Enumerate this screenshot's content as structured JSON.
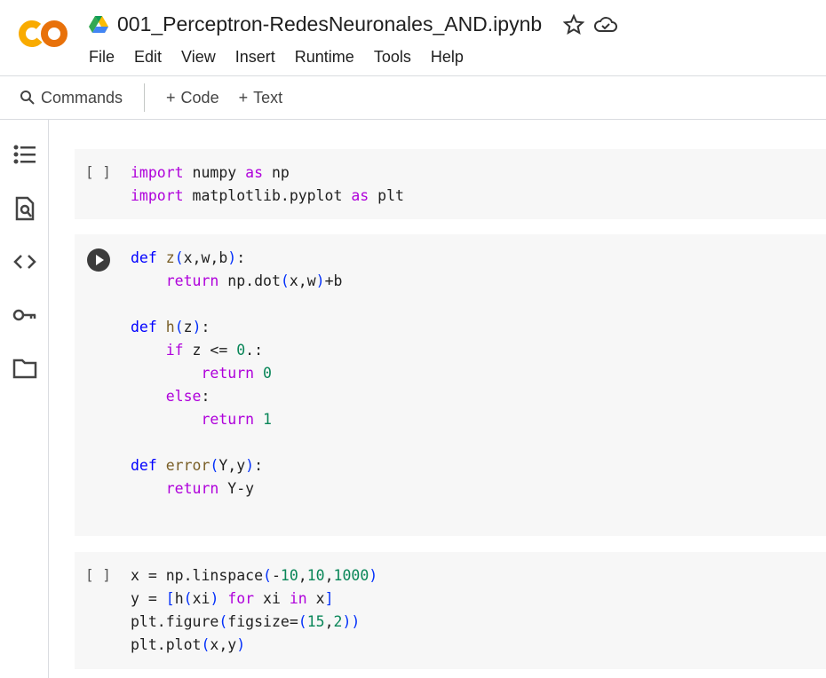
{
  "header": {
    "title": "001_Perceptron-RedesNeuronales_AND.ipynb",
    "logo_text": "CO",
    "menu": [
      "File",
      "Edit",
      "View",
      "Insert",
      "Runtime",
      "Tools",
      "Help"
    ]
  },
  "toolbar": {
    "commands": "Commands",
    "add_code": "Code",
    "add_text": "Text"
  },
  "sidebar": [
    "table-of-contents-icon",
    "find-icon",
    "code-snippets-icon",
    "secrets-key-icon",
    "files-folder-icon"
  ],
  "cells": [
    {
      "status": "[ ]",
      "lines": [
        [
          [
            "import",
            "k"
          ],
          [
            " numpy ",
            "t"
          ],
          [
            "as",
            "k"
          ],
          [
            " np",
            "t"
          ]
        ],
        [
          [
            "import",
            "k"
          ],
          [
            " matplotlib.pyplot ",
            "t"
          ],
          [
            "as",
            "k"
          ],
          [
            " plt",
            "t"
          ]
        ]
      ]
    },
    {
      "status": "run",
      "lines": [
        [
          [
            "def",
            "d"
          ],
          [
            " ",
            "t"
          ],
          [
            "z",
            "f"
          ],
          [
            "(",
            "p"
          ],
          [
            "x,w,b",
            "t"
          ],
          [
            ")",
            "p"
          ],
          [
            ":",
            "t"
          ]
        ],
        [
          [
            "    ",
            "t"
          ],
          [
            "return",
            "k"
          ],
          [
            " np.dot",
            "t"
          ],
          [
            "(",
            "p"
          ],
          [
            "x,w",
            "t"
          ],
          [
            ")",
            "p"
          ],
          [
            "+b",
            "t"
          ]
        ],
        [],
        [
          [
            "def",
            "d"
          ],
          [
            " ",
            "t"
          ],
          [
            "h",
            "f"
          ],
          [
            "(",
            "p"
          ],
          [
            "z",
            "t"
          ],
          [
            ")",
            "p"
          ],
          [
            ":",
            "t"
          ]
        ],
        [
          [
            "    ",
            "t"
          ],
          [
            "if",
            "k"
          ],
          [
            " z <= ",
            "t"
          ],
          [
            "0",
            "n"
          ],
          [
            ".:",
            "t"
          ]
        ],
        [
          [
            "        ",
            "t"
          ],
          [
            "return",
            "k"
          ],
          [
            " ",
            "t"
          ],
          [
            "0",
            "n"
          ]
        ],
        [
          [
            "    ",
            "t"
          ],
          [
            "else",
            "k"
          ],
          [
            ":",
            "t"
          ]
        ],
        [
          [
            "        ",
            "t"
          ],
          [
            "return",
            "k"
          ],
          [
            " ",
            "t"
          ],
          [
            "1",
            "n"
          ]
        ],
        [],
        [
          [
            "def",
            "d"
          ],
          [
            " ",
            "t"
          ],
          [
            "error",
            "f"
          ],
          [
            "(",
            "p"
          ],
          [
            "Y,y",
            "t"
          ],
          [
            ")",
            "p"
          ],
          [
            ":",
            "t"
          ]
        ],
        [
          [
            "    ",
            "t"
          ],
          [
            "return",
            "k"
          ],
          [
            " Y-y",
            "t"
          ]
        ]
      ]
    },
    {
      "status": "[ ]",
      "lines": [
        [
          [
            "x = np.linspace",
            "t"
          ],
          [
            "(",
            "p"
          ],
          [
            "-",
            "t"
          ],
          [
            "10",
            "n"
          ],
          [
            ",",
            "t"
          ],
          [
            "10",
            "n"
          ],
          [
            ",",
            "t"
          ],
          [
            "1000",
            "n"
          ],
          [
            ")",
            "p"
          ]
        ],
        [
          [
            "y = ",
            "t"
          ],
          [
            "[",
            "p"
          ],
          [
            "h",
            "t"
          ],
          [
            "(",
            "p"
          ],
          [
            "xi",
            "t"
          ],
          [
            ")",
            "p"
          ],
          [
            " ",
            "t"
          ],
          [
            "for",
            "k"
          ],
          [
            " xi ",
            "t"
          ],
          [
            "in",
            "k"
          ],
          [
            " x",
            "t"
          ],
          [
            "]",
            "p"
          ]
        ],
        [
          [
            "plt.figure",
            "t"
          ],
          [
            "(",
            "p"
          ],
          [
            "figsize=",
            "t"
          ],
          [
            "(",
            "p"
          ],
          [
            "15",
            "n"
          ],
          [
            ",",
            "t"
          ],
          [
            "2",
            "n"
          ],
          [
            ")",
            "p"
          ],
          [
            ")",
            "p"
          ]
        ],
        [
          [
            "plt.plot",
            "t"
          ],
          [
            "(",
            "p"
          ],
          [
            "x,y",
            "t"
          ],
          [
            ")",
            "p"
          ]
        ]
      ]
    }
  ]
}
